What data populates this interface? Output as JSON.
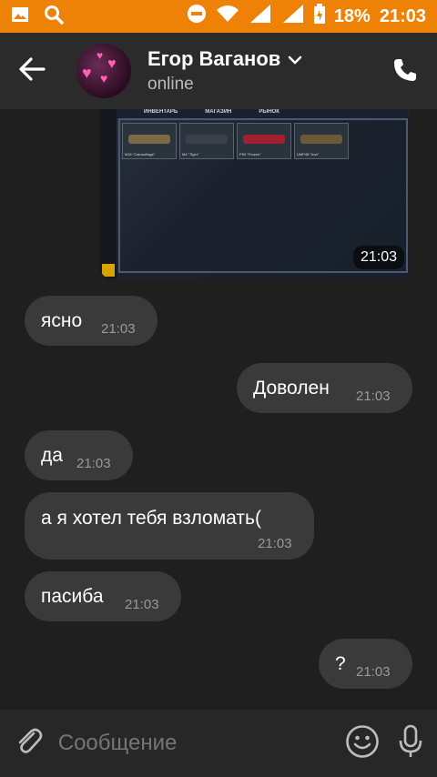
{
  "status_bar": {
    "battery": "18%",
    "time": "21:03"
  },
  "header": {
    "name": "Егор Ваганов",
    "status": "online"
  },
  "image_message": {
    "time": "21:03",
    "tabs": [
      "ИНВЕНТАРЬ",
      "МАГАЗИН",
      "РЫНОК"
    ],
    "items": [
      "M16 \"Camouflage\"",
      "M4 \"Tiger\"",
      "P90 \"Frozen\"",
      "UMP45 \"Iron\""
    ]
  },
  "messages": [
    {
      "side": "in",
      "text": "ясно",
      "time": "21:03"
    },
    {
      "side": "out",
      "text": "Доволен",
      "time": "21:03"
    },
    {
      "side": "in",
      "text": "да",
      "time": "21:03"
    },
    {
      "side": "in",
      "text": "а я хотел тебя взломать(",
      "time": "21:03"
    },
    {
      "side": "in",
      "text": "пасиба",
      "time": "21:03"
    },
    {
      "side": "out",
      "text": "?",
      "time": "21:03"
    }
  ],
  "composer": {
    "placeholder": "Сообщение"
  },
  "colors": {
    "accent": "#ee8207",
    "bubble": "#3a3a3a",
    "background": "#1f1f1f"
  }
}
